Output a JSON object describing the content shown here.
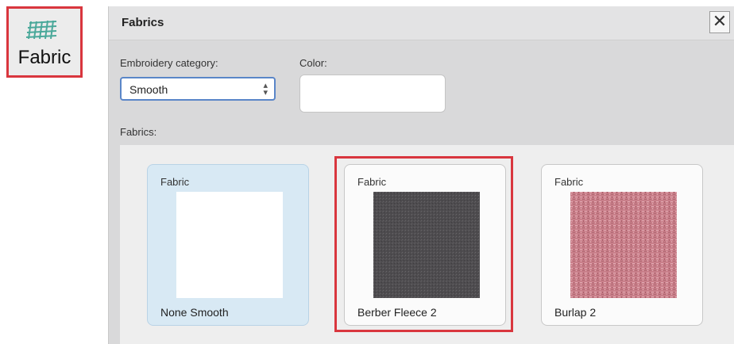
{
  "toolbar": {
    "fabric_button_label": "Fabric",
    "icon": "fabric-mesh-icon"
  },
  "dialog": {
    "title": "Fabrics",
    "close_icon": "close-icon",
    "close_label": "✕",
    "embroidery_category_label": "Embroidery category:",
    "embroidery_category_value": "Smooth",
    "color_label": "Color:",
    "fabrics_label": "Fabrics:"
  },
  "fabric_cards": [
    {
      "header": "Fabric",
      "name": "None Smooth",
      "swatch": "white"
    },
    {
      "header": "Fabric",
      "name": "Berber Fleece 2",
      "swatch": "dark-grey-fleece"
    },
    {
      "header": "Fabric",
      "name": "Burlap 2",
      "swatch": "pink-burlap"
    }
  ],
  "colors": {
    "highlight": "#d9363e",
    "select_border": "#5a86c8",
    "light_blue_card": "#d8e9f4",
    "fleece": "#4e4c4f",
    "burlap": "#c97f8a"
  }
}
